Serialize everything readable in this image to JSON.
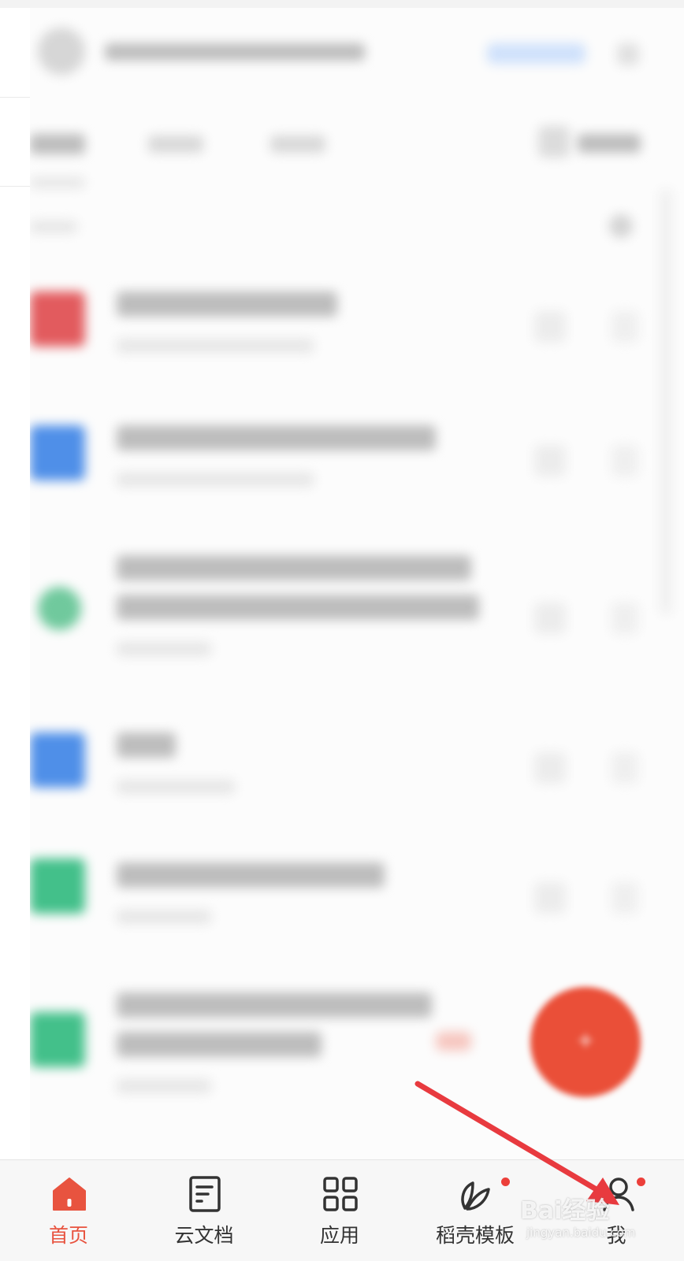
{
  "tab_bar": {
    "tabs": [
      {
        "id": "home",
        "label": "首页",
        "icon": "home-icon",
        "active": true,
        "badge": false
      },
      {
        "id": "cloud-docs",
        "label": "云文档",
        "icon": "document-icon",
        "active": false,
        "badge": false
      },
      {
        "id": "apps",
        "label": "应用",
        "icon": "grid-icon",
        "active": false,
        "badge": false
      },
      {
        "id": "templates",
        "label": "稻壳模板",
        "icon": "leaf-icon",
        "active": false,
        "badge": true
      },
      {
        "id": "me",
        "label": "我",
        "icon": "person-icon",
        "active": false,
        "badge": true
      }
    ]
  },
  "colors": {
    "accent": "#e8533f",
    "fab": "#ea4f38",
    "badge": "#ec3f3a",
    "annotation_arrow": "#e83a3f"
  },
  "fab": {
    "icon": "plus-icon"
  },
  "watermark": {
    "brand": "Bai经验",
    "url": "jingyan.baidu.com"
  }
}
